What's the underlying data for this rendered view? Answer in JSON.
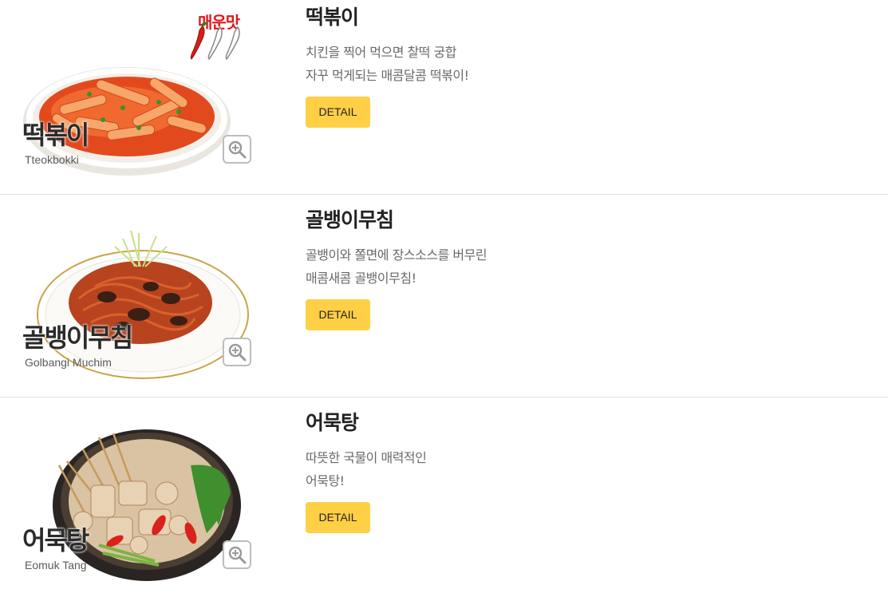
{
  "menu": {
    "items": [
      {
        "title": "떡볶이",
        "desc_line1": "치킨을 찍어 먹으면 찰떡 궁합",
        "desc_line2": "자꾸 먹게되는 매콤달콤 떡볶이!",
        "detail_label": "DETAIL",
        "thumb_name_ko": "떡볶이",
        "thumb_name_en": "Tteokbokki",
        "spicy_badge": "매운맛",
        "icon": "zoom-in-icon"
      },
      {
        "title": "골뱅이무침",
        "desc_line1": "골뱅이와 쫄면에 장스소스를 버무린",
        "desc_line2": "매콤새콤 골뱅이무침!",
        "detail_label": "DETAIL",
        "thumb_name_ko": "골뱅이무침",
        "thumb_name_en": "Golbangi Muchim",
        "icon": "zoom-in-icon"
      },
      {
        "title": "어묵탕",
        "desc_line1": "따뜻한 국물이 매력적인",
        "desc_line2": "어묵탕!",
        "detail_label": "DETAIL",
        "thumb_name_ko": "어묵탕",
        "thumb_name_en": "Eomuk Tang",
        "icon": "zoom-in-icon"
      }
    ]
  },
  "colors": {
    "detail_button": "#ffcf45",
    "spicy_text": "#e3151a",
    "divider": "#e2e2e2"
  }
}
